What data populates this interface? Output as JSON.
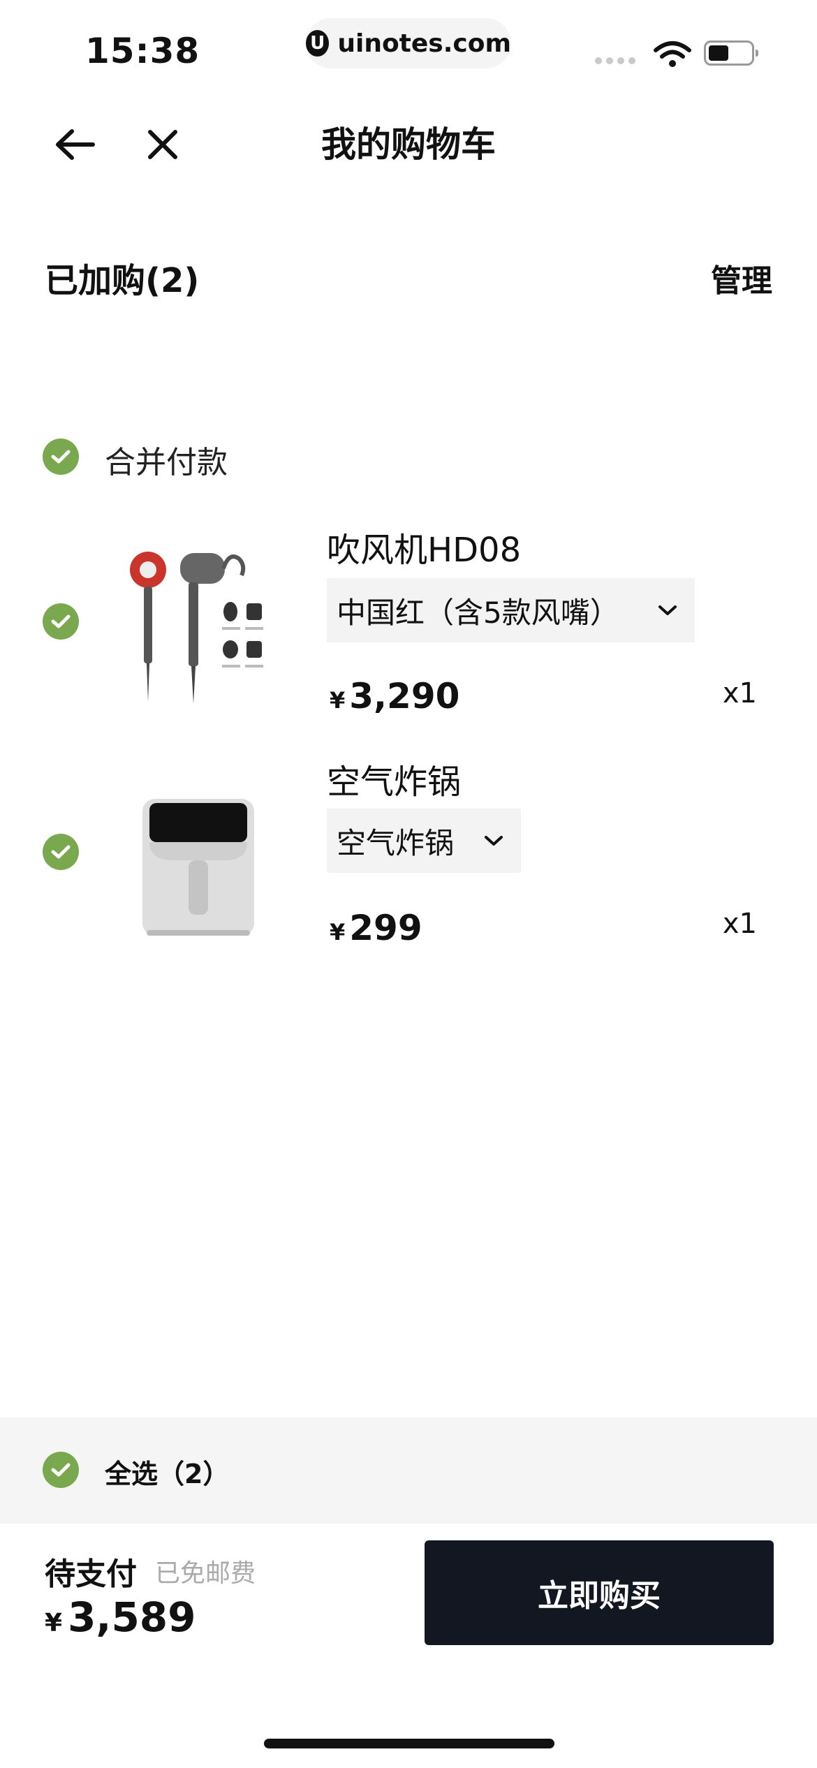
{
  "status_bar": {
    "time": "15:38",
    "url": "uinotes.com",
    "url_logo": "U"
  },
  "nav": {
    "title": "我的购物车"
  },
  "cart": {
    "added_label": "已加购(2)",
    "manage_label": "管理",
    "merge_label": "合并付款",
    "items": [
      {
        "name": "吹风机HD08",
        "variant": "中国红（含5款风嘴）",
        "currency": "¥",
        "price": "3,290",
        "qty": "x1"
      },
      {
        "name": "空气炸锅",
        "variant": "空气炸锅",
        "currency": "¥",
        "price": "299",
        "qty": "x1"
      }
    ]
  },
  "footer": {
    "select_all": "全选（2）",
    "pending_label": "待支付",
    "shipping_note": "已免邮费",
    "currency": "¥",
    "total": "3,589",
    "buy_label": "立即购买"
  },
  "colors": {
    "check": "#7aa84e",
    "buy_button": "#121722"
  }
}
